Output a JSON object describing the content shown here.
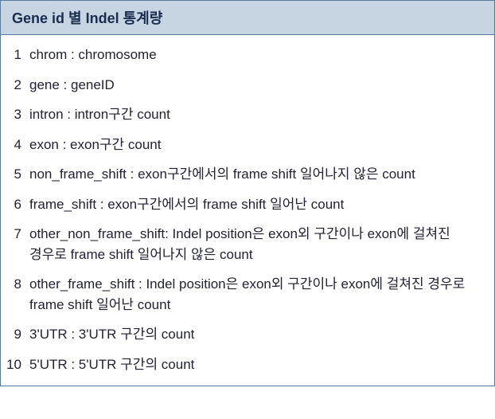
{
  "title": "Gene id 별 Indel 통계량",
  "items": [
    {
      "num": "1",
      "text": "chrom : chromosome"
    },
    {
      "num": "2",
      "text": "gene : geneID"
    },
    {
      "num": "3",
      "text": "intron : intron구간 count"
    },
    {
      "num": "4",
      "text": "exon : exon구간 count"
    },
    {
      "num": "5",
      "text": "non_frame_shift : exon구간에서의 frame shift 일어나지 않은 count"
    },
    {
      "num": "6",
      "text": "frame_shift : exon구간에서의 frame shift 일어난 count"
    },
    {
      "num": "7",
      "text": "other_non_frame_shift: Indel position은 exon외 구간이나 exon에 걸쳐진 경우로 frame shift 일어나지 않은 count"
    },
    {
      "num": "8",
      "text": "other_frame_shift : Indel position은 exon외 구간이나 exon에 걸쳐진 경우로 frame shift 일어난 count"
    },
    {
      "num": "9",
      "text": "3'UTR : 3'UTR 구간의 count"
    },
    {
      "num": "10",
      "text": "5'UTR : 5'UTR 구간의 count"
    }
  ]
}
